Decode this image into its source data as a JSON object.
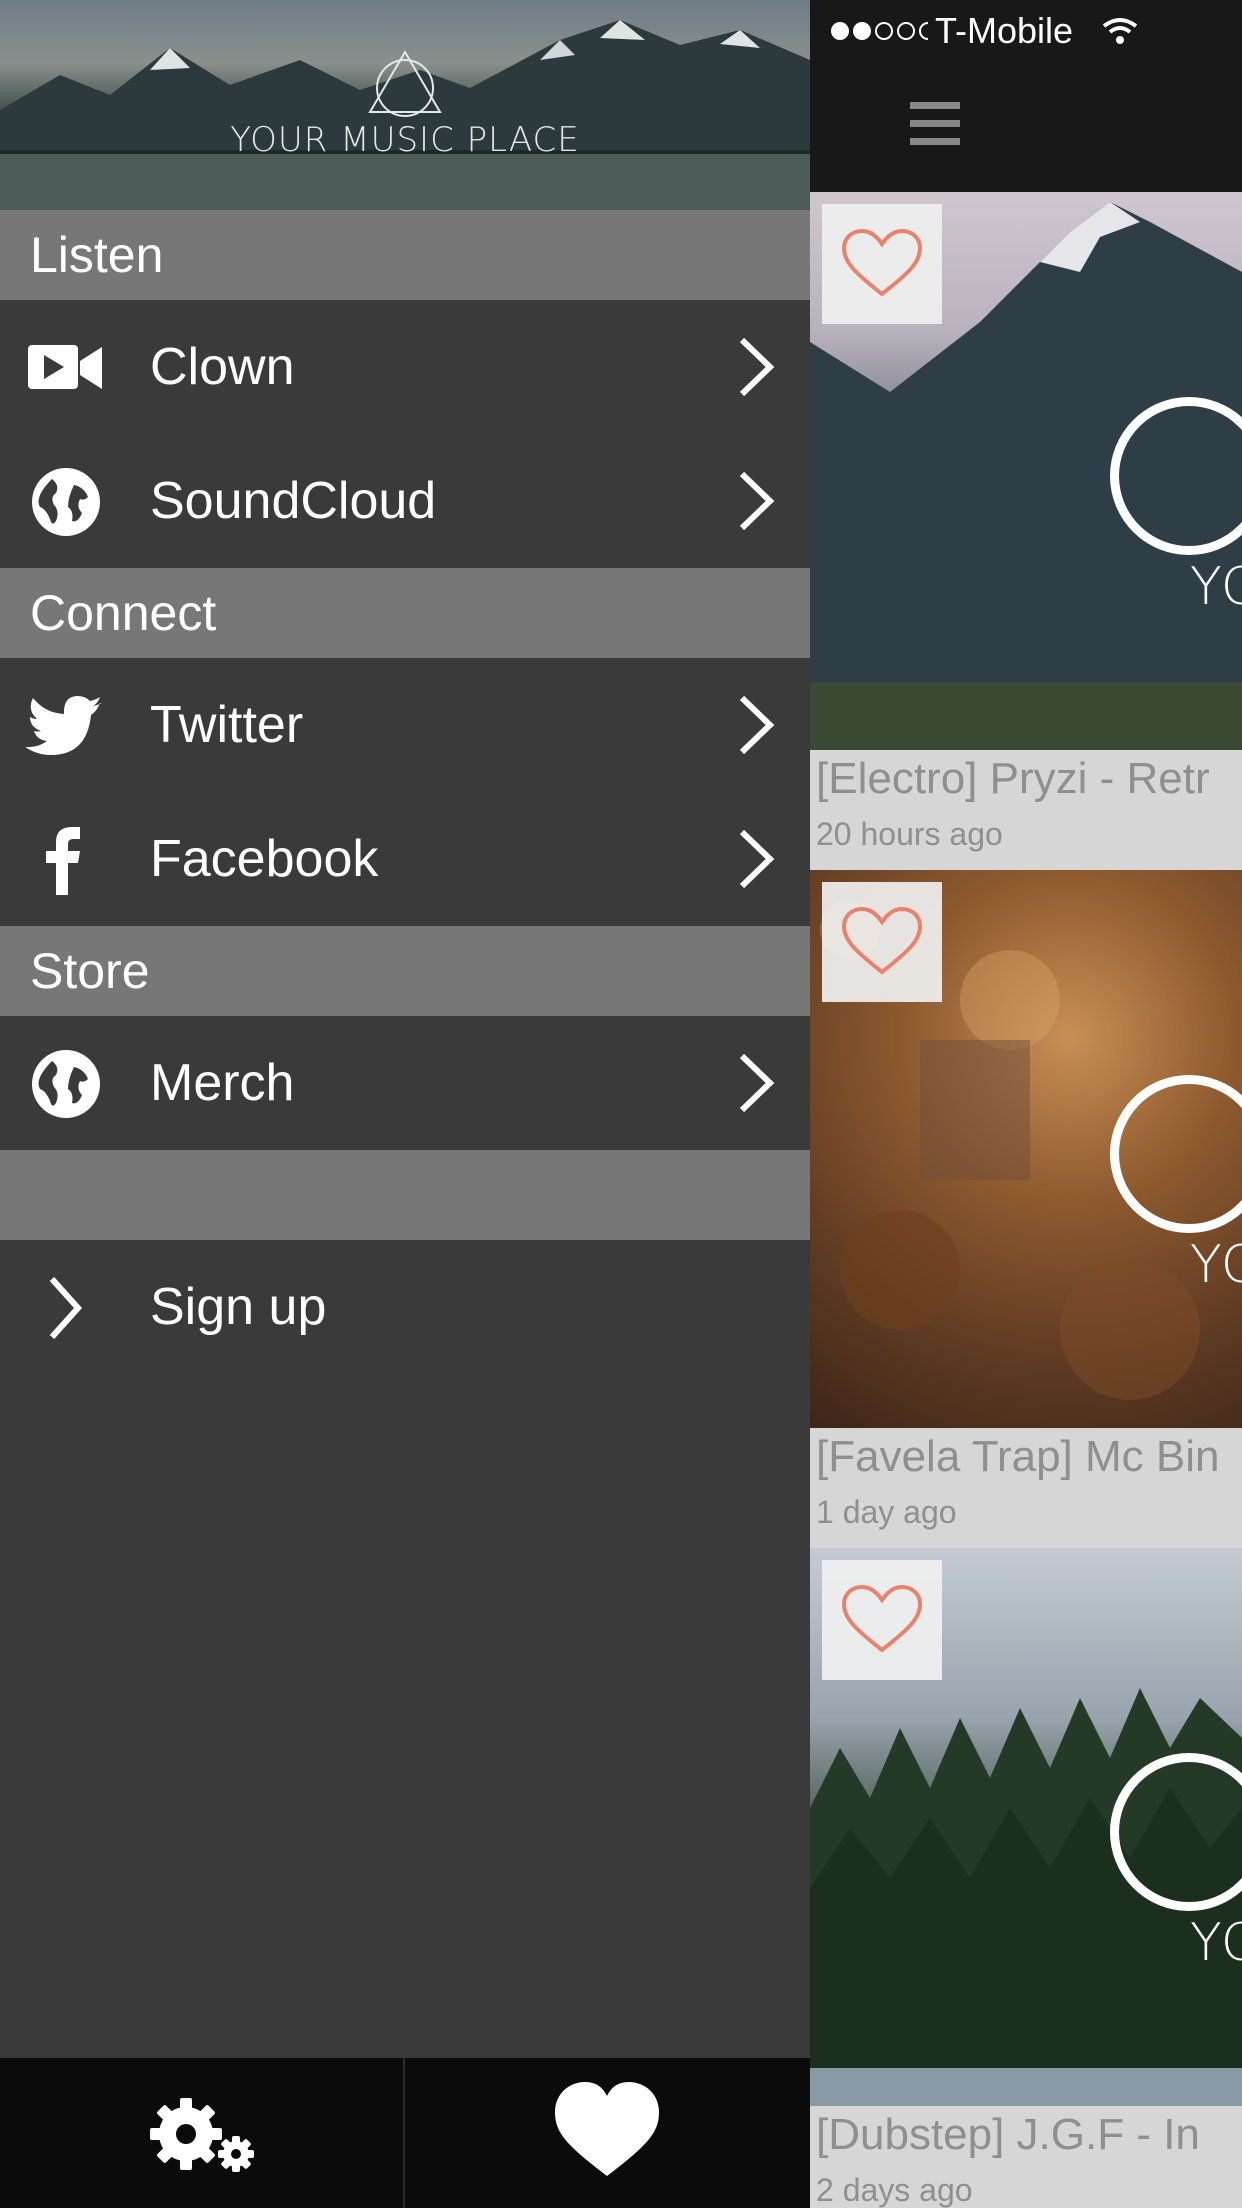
{
  "status_bar": {
    "carrier": "T-Mobile"
  },
  "drawer": {
    "logo_text": "YOUR MUSIC PLACE",
    "sections": [
      {
        "header": "Listen",
        "items": [
          {
            "label": "Clown",
            "icon": "video-camera-icon"
          },
          {
            "label": "SoundCloud",
            "icon": "globe-icon"
          }
        ]
      },
      {
        "header": "Connect",
        "items": [
          {
            "label": "Twitter",
            "icon": "twitter-bird-icon"
          },
          {
            "label": "Facebook",
            "icon": "facebook-f-icon"
          }
        ]
      },
      {
        "header": "Store",
        "items": [
          {
            "label": "Merch",
            "icon": "globe-icon"
          }
        ]
      }
    ],
    "signup_label": "Sign up",
    "bottom_bar": {
      "left_icon": "gears-icon",
      "right_icon": "heart-icon"
    }
  },
  "feed": {
    "cards": [
      {
        "title": "[Electro] Pryzi - Retr",
        "time": "20 hours ago",
        "partial_logo_text": "YO"
      },
      {
        "title": "[Favela Trap] Mc Bin",
        "time": "1 day ago",
        "partial_logo_text": "YO"
      },
      {
        "title": "[Dubstep] J.G.F - In",
        "time": "2 days ago",
        "partial_logo_text": "YO"
      }
    ]
  },
  "colors": {
    "accent_heart": "#e8826c",
    "drawer_bg": "#3a3a3a",
    "section_header_bg": "#777777",
    "bar_bg": "#0b0b0b"
  }
}
